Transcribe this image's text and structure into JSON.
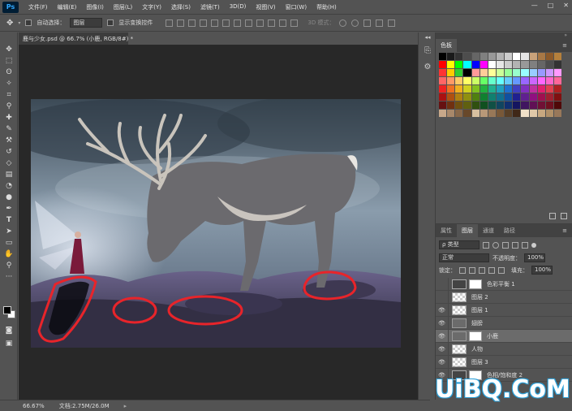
{
  "app": {
    "logo": "Ps"
  },
  "menu": [
    "文件(F)",
    "编辑(E)",
    "图像(I)",
    "图层(L)",
    "文字(Y)",
    "选择(S)",
    "滤镜(T)",
    "3D(D)",
    "视图(V)",
    "窗口(W)",
    "帮助(H)"
  ],
  "window_controls": {
    "minimize": "—",
    "restore": "□",
    "close": "✕"
  },
  "options": {
    "auto_select_label": "自动选择：",
    "auto_select_value": "图层",
    "show_transform_label": "显示变换控件",
    "mode3d_label": "3D 模式："
  },
  "document": {
    "tab_title": "鹿与少女.psd @ 66.7% (小鹿, RGB/8#) *"
  },
  "status": {
    "zoom": "66.67%",
    "doc_info": "文档:2.75M/26.0M"
  },
  "swatches": {
    "tab": "色板",
    "colors": [
      [
        "#000000",
        "#1a1a1a",
        "#333333",
        "#4d4d4d",
        "#666666",
        "#808080",
        "#999999",
        "#b3b3b3",
        "#cccccc",
        "#ffffff",
        "#e5e5e5",
        "#c9a27a",
        "#a87845",
        "#8c5a2a",
        "#b5803c"
      ],
      [
        "#ff0000",
        "#ffff00",
        "#00ff00",
        "#00ffff",
        "#0000ff",
        "#ff00ff",
        "#ffffff",
        "#e6e6e6",
        "#cccccc",
        "#b3b3b3",
        "#999999",
        "#808080",
        "#666666",
        "#4d4d4d",
        "#333333"
      ],
      [
        "#ff3333",
        "#ffcc00",
        "#33cc33",
        "#000000",
        "#ff9999",
        "#ffcc99",
        "#ffff99",
        "#ccff99",
        "#99ff99",
        "#99ffcc",
        "#99ffff",
        "#99ccff",
        "#9999ff",
        "#cc99ff",
        "#ff99ff"
      ],
      [
        "#ff6666",
        "#ff9966",
        "#ffcc66",
        "#ffff66",
        "#ccff66",
        "#66ff66",
        "#66ffcc",
        "#66ffff",
        "#66ccff",
        "#6699ff",
        "#9966ff",
        "#cc66ff",
        "#ff66ff",
        "#ff66cc",
        "#ff6699"
      ],
      [
        "#ee2222",
        "#f07020",
        "#f0b020",
        "#d0d020",
        "#80c020",
        "#20b040",
        "#20b090",
        "#20a0c0",
        "#2070d0",
        "#4040c0",
        "#8030c0",
        "#c030a0",
        "#e02070",
        "#e04050",
        "#b02020"
      ],
      [
        "#aa1111",
        "#b05010",
        "#b08010",
        "#909010",
        "#508010",
        "#108030",
        "#108070",
        "#107090",
        "#1050a0",
        "#202090",
        "#602090",
        "#901080",
        "#a01050",
        "#a02030",
        "#801010"
      ],
      [
        "#661111",
        "#703010",
        "#705010",
        "#606010",
        "#305010",
        "#105020",
        "#105045",
        "#104560",
        "#103070",
        "#151560",
        "#401560",
        "#601055",
        "#701035",
        "#701020",
        "#500808"
      ],
      [
        "#c8a88a",
        "#a8886a",
        "#88684a",
        "#68482a",
        "#d8c0a0",
        "#b89878",
        "#987858",
        "#785838",
        "#584028",
        "#402818",
        "#f0e0c8",
        "#e0c8a8",
        "#c8a880",
        "#b09068",
        "#98785a"
      ]
    ]
  },
  "layers_panel": {
    "tabs": [
      "属性",
      "图层",
      "通道",
      "路径"
    ],
    "active_tab": "图层",
    "filter_label": "ρ 类型",
    "blend_mode": "正常",
    "opacity_label": "不透明度：",
    "opacity_value": "100%",
    "lock_label": "锁定：",
    "fill_label": "填充：",
    "fill_value": "100%",
    "layers": [
      {
        "name": "色彩平衡 1",
        "visible": false,
        "thumb": "adj",
        "mask": true,
        "selected": false
      },
      {
        "name": "图层 2",
        "visible": false,
        "thumb": "trans",
        "mask": false,
        "selected": false
      },
      {
        "name": "图层 1",
        "visible": true,
        "thumb": "trans",
        "mask": false,
        "selected": false
      },
      {
        "name": "翅膀",
        "visible": true,
        "thumb": "photo",
        "mask": false,
        "selected": false
      },
      {
        "name": "小鹿",
        "visible": true,
        "thumb": "photo",
        "mask": true,
        "selected": true
      },
      {
        "name": "人物",
        "visible": true,
        "thumb": "trans",
        "mask": false,
        "selected": false
      },
      {
        "name": "图层 3",
        "visible": true,
        "thumb": "trans",
        "mask": false,
        "selected": false
      },
      {
        "name": "色相/饱和度 2",
        "visible": true,
        "thumb": "adj",
        "mask": true,
        "selected": false
      }
    ]
  },
  "watermark": "UiBQ.CoM"
}
